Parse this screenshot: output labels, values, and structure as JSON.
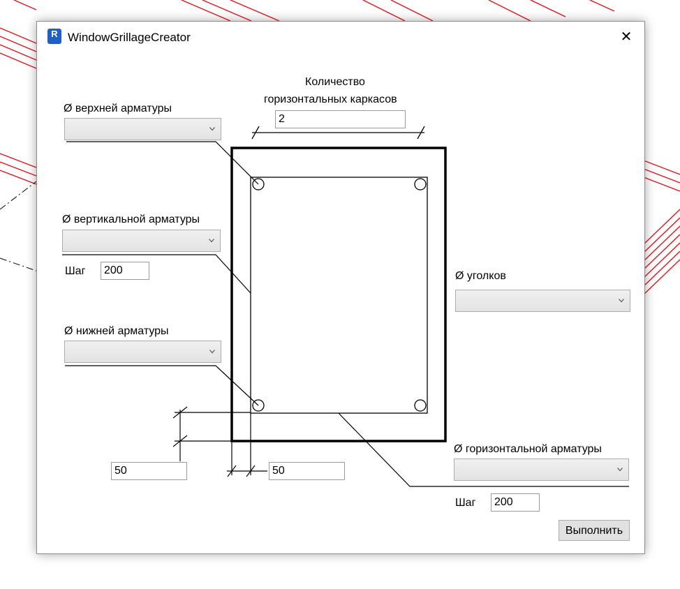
{
  "window": {
    "title": "WindowGrillageCreator",
    "app_icon_letter": "R",
    "close_glyph": "✕"
  },
  "form": {
    "top_rebar_label": "Ø верхней арматуры",
    "vertical_rebar_label": "Ø вертикальной арматуры",
    "vertical_step_label": "Шаг",
    "vertical_step_value": "200",
    "bottom_rebar_label": "Ø нижней арматуры",
    "horizontal_frames_label_line1": "Количество",
    "horizontal_frames_label_line2": "горизонтальных каркасов",
    "horizontal_frames_value": "2",
    "corners_label": "Ø уголков",
    "horizontal_rebar_label": "Ø горизонтальной арматуры",
    "horizontal_step_label": "Шаг",
    "horizontal_step_value": "200",
    "cover_bottom_value": "50",
    "cover_side_value": "50",
    "execute_button": "Выполнить"
  },
  "colors": {
    "background_lines": "#e8141c",
    "accent_icon": "#1f5fc8"
  }
}
